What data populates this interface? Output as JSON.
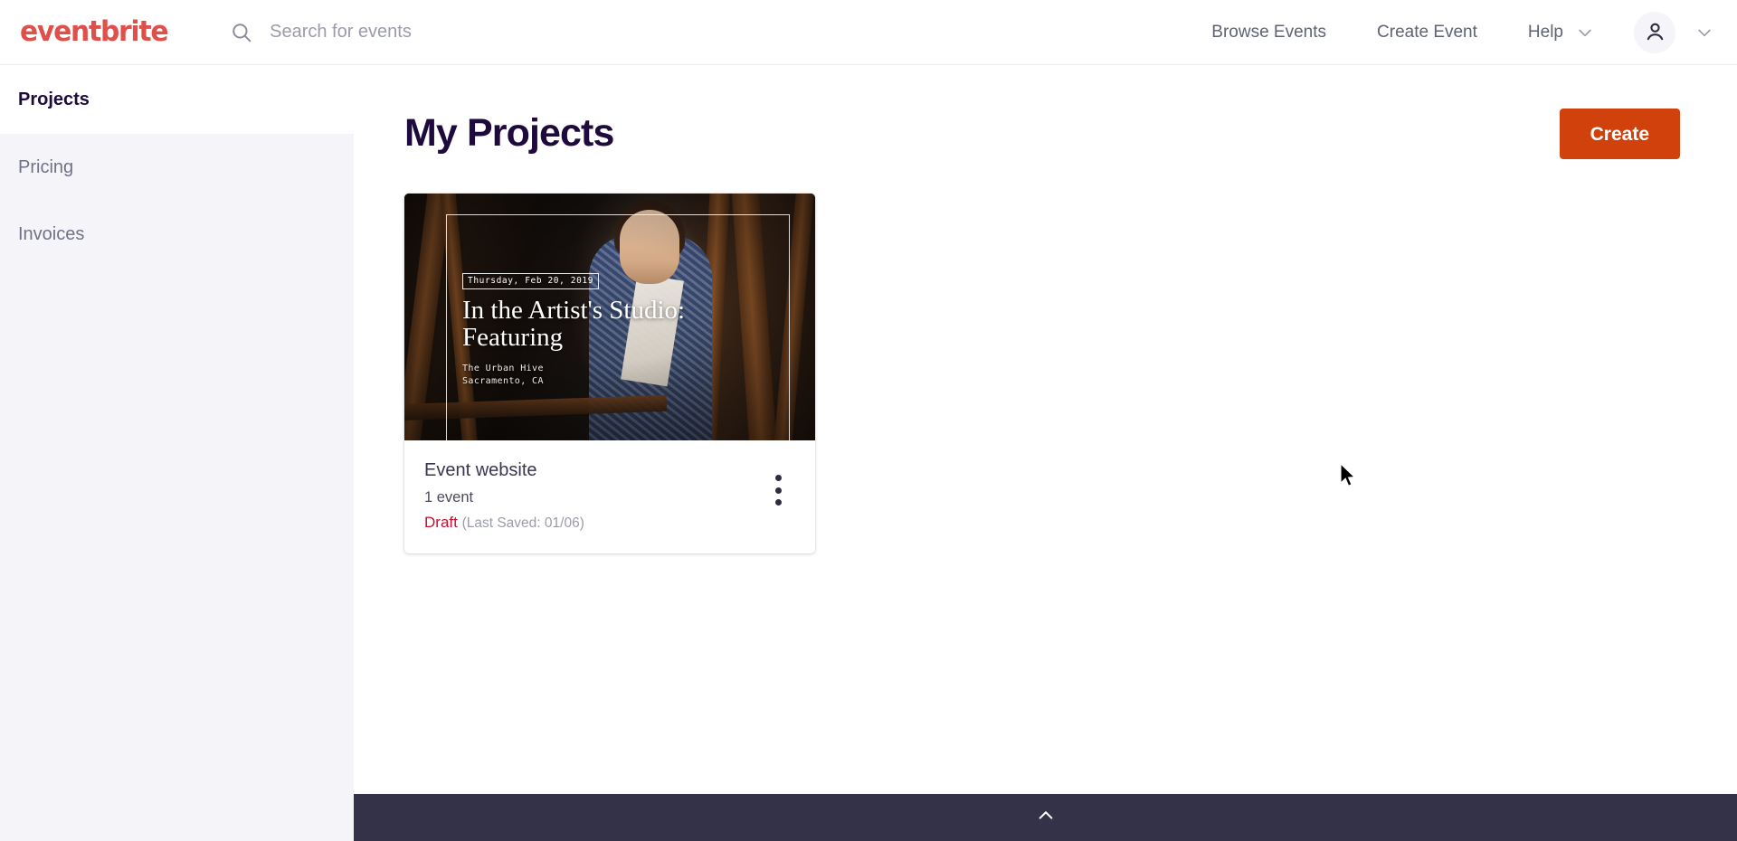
{
  "header": {
    "brand": "eventbrite",
    "brand_color": "#e0504a",
    "search": {
      "icon": "search-icon",
      "placeholder": "Search for events",
      "value": ""
    },
    "nav": [
      {
        "label": "Browse Events",
        "has_caret": false
      },
      {
        "label": "Create Event",
        "has_caret": false
      },
      {
        "label": "Help",
        "has_caret": true
      }
    ],
    "account": {
      "icon": "user-avatar-icon",
      "caret_icon": "chevron-down-icon"
    }
  },
  "sidebar": {
    "items": [
      {
        "label": "Projects",
        "active": true
      },
      {
        "label": "Pricing",
        "active": false
      },
      {
        "label": "Invoices",
        "active": false
      }
    ],
    "background": "#f5f4f8"
  },
  "main": {
    "title": "My Projects",
    "create_button": {
      "label": "Create",
      "color": "#d1410c"
    },
    "projects": [
      {
        "name": "Event website",
        "event_count": "1 event",
        "status": "Draft",
        "status_color": "#c8102e",
        "saved_note": "(Last Saved: 01/06)",
        "menu_icon": "kebab-menu-icon",
        "thumbnail": {
          "date": "Thursday, Feb 20, 2019",
          "title": "In the Artist's Studio: Featuring",
          "venue": "The Urban Hive",
          "location": "Sacramento, CA"
        }
      }
    ]
  },
  "bottom_bar": {
    "icon": "chevron-up-icon",
    "color": "#333248"
  }
}
